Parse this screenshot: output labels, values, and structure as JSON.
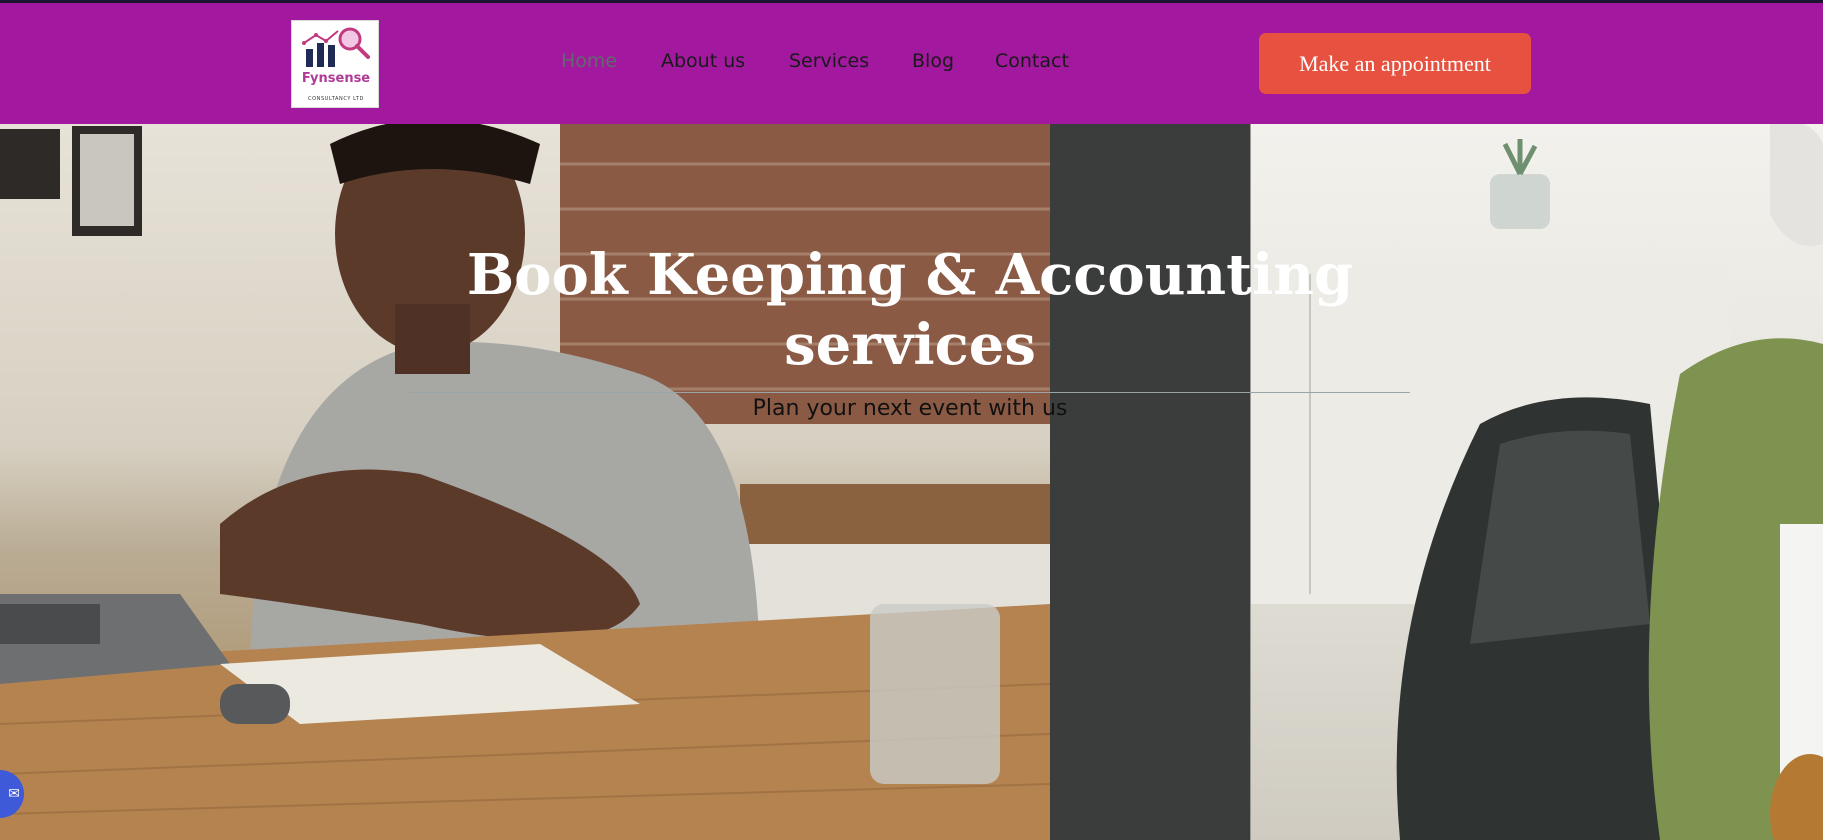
{
  "brand": {
    "name": "Fynsense",
    "tagline": "CONSULTANCY LTD",
    "colors": {
      "header": "#a2189f",
      "cta": "#e7513f",
      "logo_text": "#b03a97"
    }
  },
  "nav": {
    "items": [
      {
        "label": "Home",
        "active": true
      },
      {
        "label": "About us",
        "active": false
      },
      {
        "label": "Services",
        "active": false
      },
      {
        "label": "Blog",
        "active": false
      },
      {
        "label": "Contact",
        "active": false
      }
    ]
  },
  "header": {
    "cta_label": "Make an appointment"
  },
  "hero": {
    "title": "Book Keeping & Accounting services",
    "subtitle": "Plan your next event with us"
  },
  "fab": {
    "icon": "chat-icon"
  }
}
